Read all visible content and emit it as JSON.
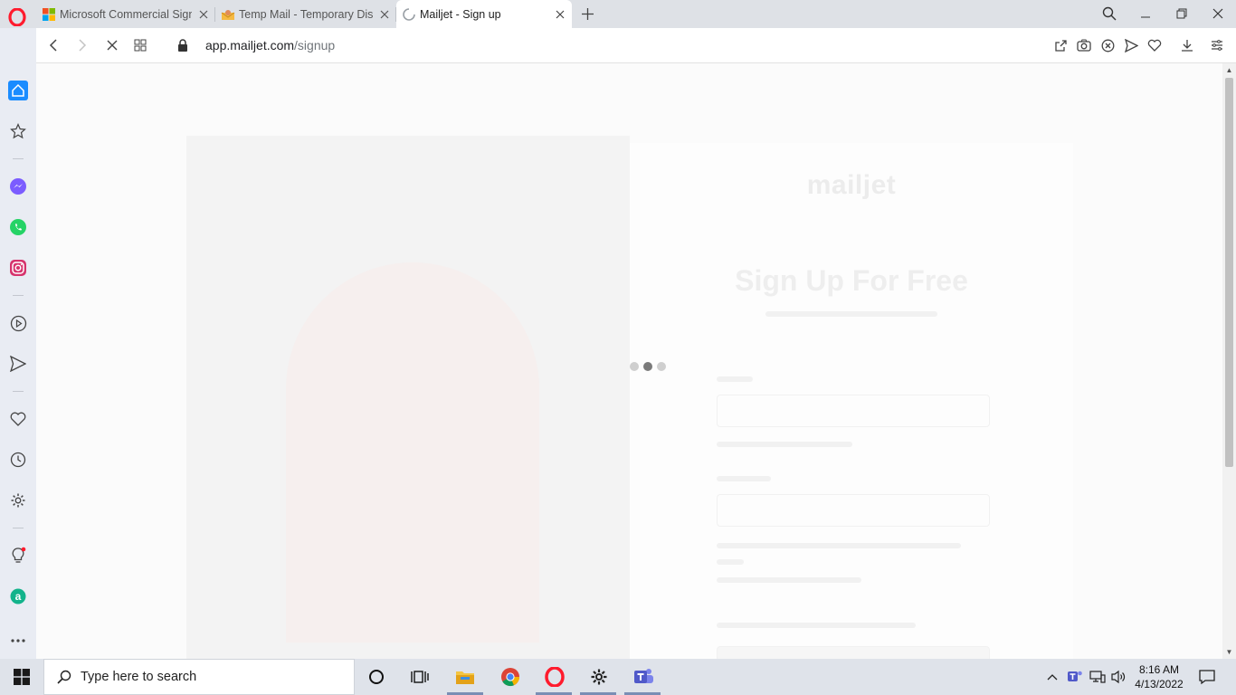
{
  "browser": {
    "tabs": [
      {
        "title": "Microsoft Commercial Sign",
        "favicon": "microsoft-icon",
        "active": false
      },
      {
        "title": "Temp Mail - Temporary Dis",
        "favicon": "tempmail-icon",
        "active": false
      },
      {
        "title": "Mailjet - Sign up",
        "favicon": "loading-spinner-icon",
        "active": true
      }
    ],
    "url_host": "app.mailjet.com",
    "url_path": "/signup"
  },
  "sidebar": {
    "items": [
      "home-icon",
      "star-icon",
      "messenger-icon",
      "whatsapp-icon",
      "instagram-icon",
      "player-icon",
      "send-icon",
      "heart-icon",
      "history-icon",
      "settings-icon",
      "lightbulb-icon",
      "aria-icon",
      "more-icon"
    ]
  },
  "page": {
    "logo": "mailjet",
    "heading": "Sign Up For Free",
    "loading": true
  },
  "taskbar": {
    "search_placeholder": "Type here to search",
    "time": "8:16 AM",
    "date": "4/13/2022",
    "apps": [
      "cortana-icon",
      "task-view-icon",
      "file-explorer-icon",
      "chrome-icon",
      "opera-icon",
      "settings-icon",
      "teams-icon"
    ]
  },
  "colors": {
    "opera_red": "#ff1b2d",
    "sidebar_bg": "#e9ecf3",
    "tabstrip_bg": "#dee1e6",
    "home_blue": "#1a8cff"
  }
}
